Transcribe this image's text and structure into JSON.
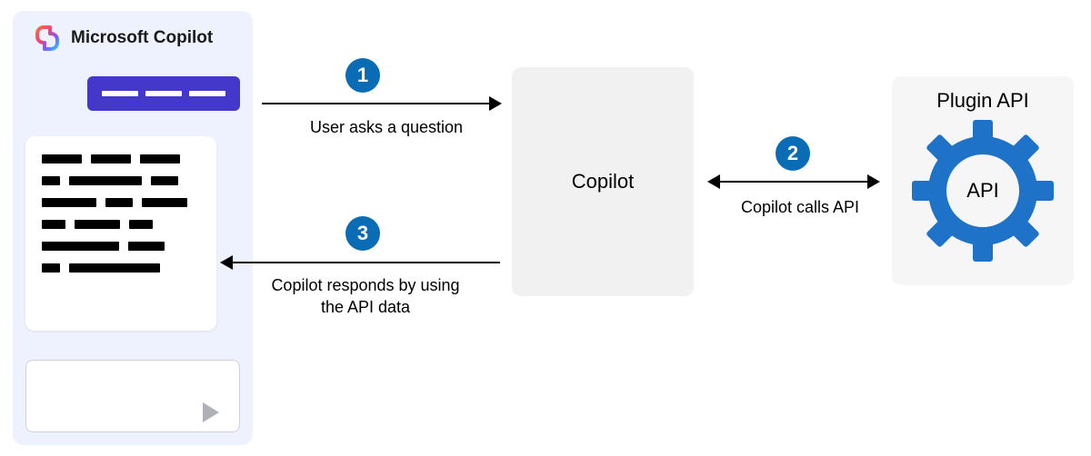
{
  "panel": {
    "title": "Microsoft Copilot"
  },
  "center": {
    "label": "Copilot"
  },
  "plugin": {
    "title": "Plugin API",
    "gear_label": "API"
  },
  "steps": {
    "one": {
      "num": "1",
      "label": "User asks a question"
    },
    "two": {
      "num": "2",
      "label": "Copilot calls API"
    },
    "three": {
      "num": "3",
      "label": "Copilot responds by using\nthe API data"
    }
  },
  "colors": {
    "badge": "#0a6cb4",
    "accent": "#4338ca",
    "gear": "#1e73c8",
    "panel_bg": "#eef2ff"
  }
}
